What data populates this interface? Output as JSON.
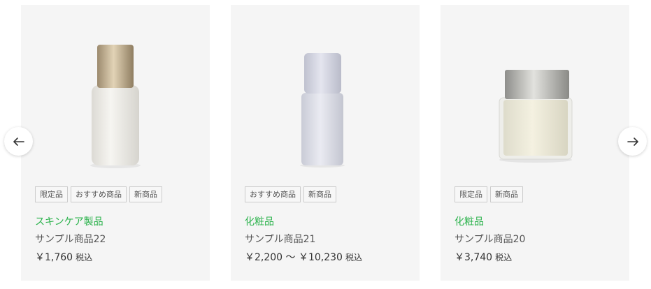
{
  "carousel": {
    "prev_icon": "arrow-left-icon",
    "next_icon": "arrow-right-icon",
    "products": [
      {
        "tags": [
          "限定品",
          "おすすめ商品",
          "新商品"
        ],
        "category": "スキンケア製品",
        "name": "サンプル商品22",
        "price": "￥1,760",
        "tax": "税込",
        "image": "white-bottle-gold-cap"
      },
      {
        "tags": [
          "おすすめ商品",
          "新商品"
        ],
        "category": "化粧品",
        "name": "サンプル商品21",
        "price": "￥2,200 〜 ￥10,230",
        "tax": "税込",
        "image": "lavender-bottle"
      },
      {
        "tags": [
          "限定品",
          "新商品"
        ],
        "category": "化粧品",
        "name": "サンプル商品20",
        "price": "￥3,740",
        "tax": "税込",
        "image": "cream-jar-silver-lid"
      }
    ]
  },
  "colors": {
    "category_green": "#2bb24c",
    "card_background": "#f5f5f5"
  }
}
